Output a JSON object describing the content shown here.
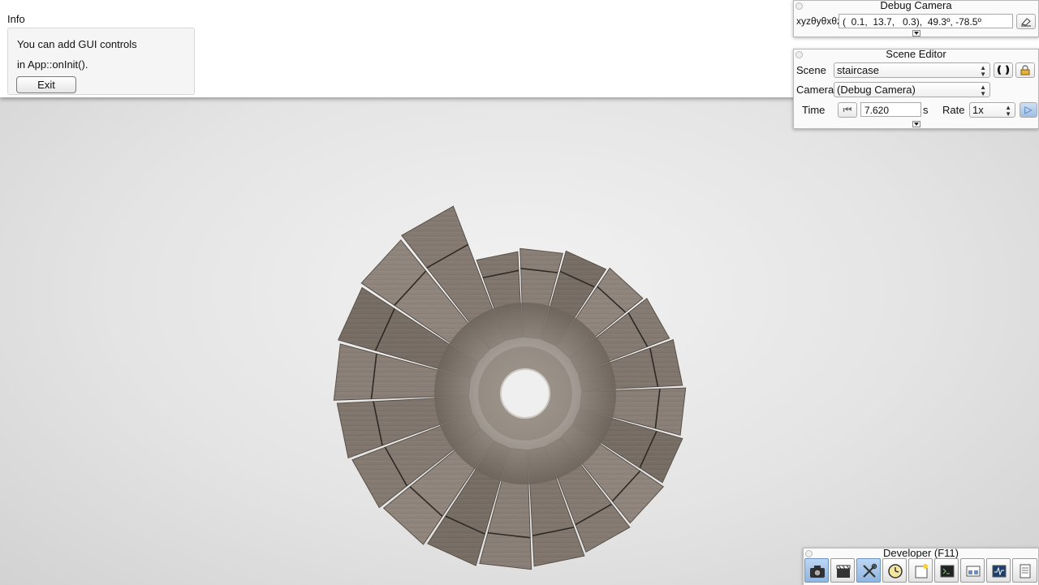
{
  "info": {
    "title": "Info",
    "line1": "You can add GUI controls",
    "line2": "in App::onInit().",
    "exit_label": "Exit"
  },
  "debug_camera": {
    "title": "Debug Camera",
    "xyz_label": "xyzθyθxθz",
    "value": "(  0.1,  13.7,   0.3),  49.3º, -78.5º"
  },
  "scene_editor": {
    "title": "Scene Editor",
    "scene_label": "Scene",
    "scene_value": "staircase",
    "camera_label": "Camera",
    "camera_value": "(Debug Camera)",
    "time_label": "Time",
    "time_value": "7.620",
    "time_unit": "s",
    "rate_label": "Rate",
    "rate_value": "1x"
  },
  "developer": {
    "title": "Developer (F11)",
    "buttons": [
      {
        "icon": "camera-icon"
      },
      {
        "icon": "clapperboard-icon"
      },
      {
        "icon": "tools-icon"
      },
      {
        "icon": "clock-icon"
      },
      {
        "icon": "new-window-icon"
      },
      {
        "icon": "terminal-icon"
      },
      {
        "icon": "scene-graph-icon"
      },
      {
        "icon": "profiler-icon"
      },
      {
        "icon": "log-icon"
      }
    ]
  },
  "colors": {
    "wood_dark": "#5f544c",
    "wood_mid": "#8a8078",
    "wood_light": "#a89e94",
    "accent_blue": "#8fb6e0"
  }
}
